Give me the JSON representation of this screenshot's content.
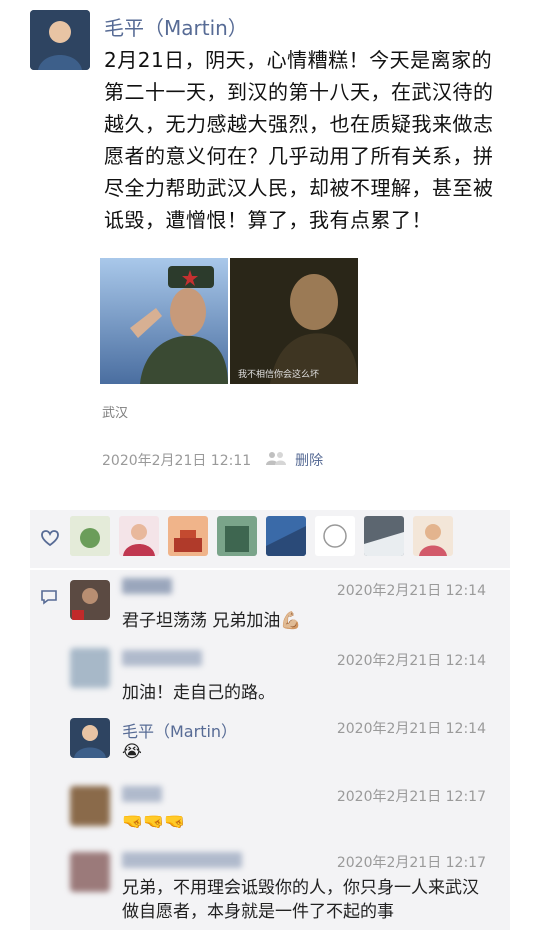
{
  "post": {
    "author": "毛平（Martin）",
    "text": "2月21日，阴天，心情糟糕！今天是离家的第二十一天，到汉的第十八天，在武汉待的越久，无力感越大强烈，也在质疑我来做志愿者的意义何在？几乎动用了所有关系，拼尽全力帮助武汉人民，却被不理解，甚至被诋毁，遭憎恨！算了，我有点累了！",
    "location": "武汉",
    "timestamp": "2020年2月21日 12:11",
    "delete_label": "删除",
    "image2_caption": "我不相信你会这么坏"
  },
  "likes": {
    "icon": "heart-icon"
  },
  "comments": [
    {
      "name": "",
      "time": "2020年2月21日 12:14",
      "text": "君子坦荡荡 兄弟加油💪🏼"
    },
    {
      "name": "",
      "time": "2020年2月21日 12:14",
      "text": "加油！走自己的路。"
    },
    {
      "name": "毛平（Martin）",
      "time": "2020年2月21日 12:14",
      "text": "😭"
    },
    {
      "name": "",
      "time": "2020年2月21日 12:17",
      "text": "🤜🤜🤜"
    },
    {
      "name": "",
      "time": "2020年2月21日 12:17",
      "text": "兄弟，不用理会诋毁你的人，你只身一人来武汉做自愿者，本身就是一件了不起的事"
    }
  ],
  "colors": {
    "link": "#576b95",
    "panel": "#f3f3f5"
  }
}
